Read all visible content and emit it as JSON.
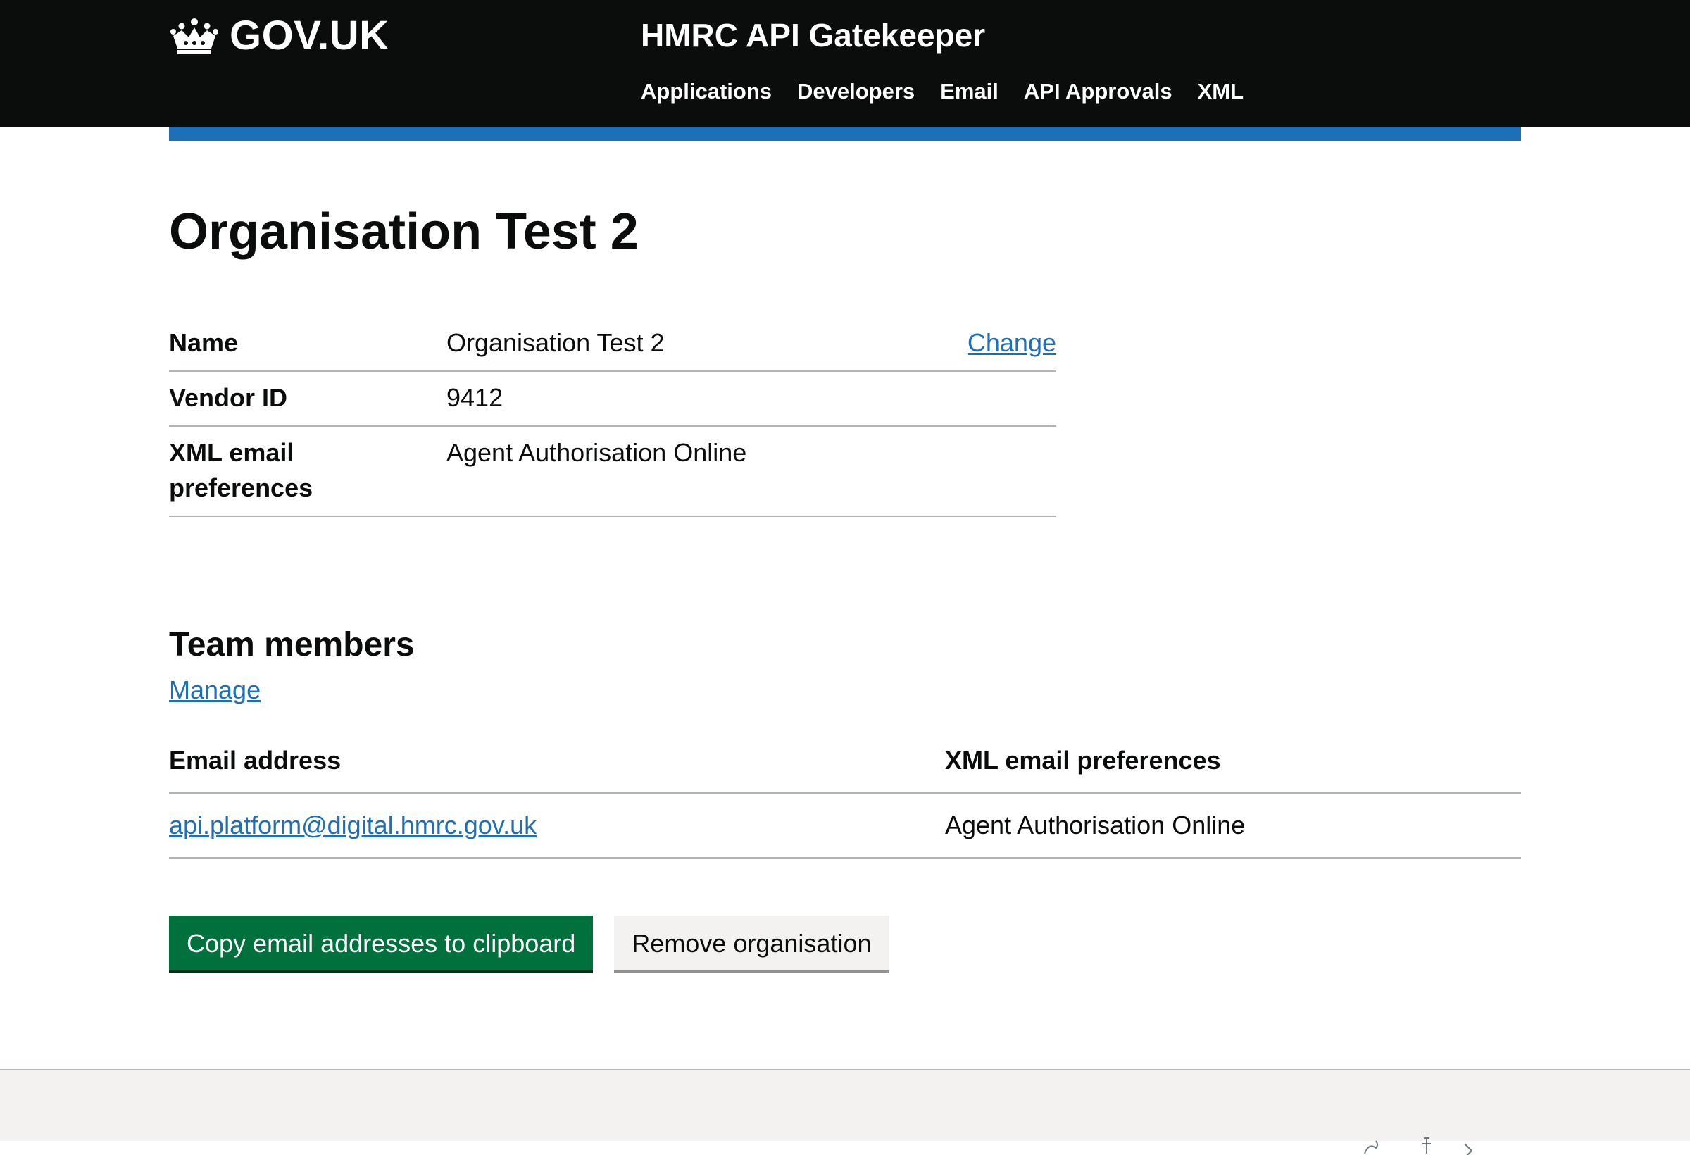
{
  "header": {
    "logo_text": "GOV.UK",
    "service_name": "HMRC API Gatekeeper",
    "nav": [
      {
        "label": "Applications"
      },
      {
        "label": "Developers"
      },
      {
        "label": "Email"
      },
      {
        "label": "API Approvals"
      },
      {
        "label": "XML"
      }
    ]
  },
  "page": {
    "title": "Organisation Test 2"
  },
  "summary": {
    "rows": [
      {
        "key": "Name",
        "value": "Organisation Test 2",
        "action": "Change"
      },
      {
        "key": "Vendor ID",
        "value": "9412"
      },
      {
        "key": "XML email preferences",
        "value": "Agent Authorisation Online"
      }
    ]
  },
  "team": {
    "heading": "Team members",
    "manage_label": "Manage",
    "columns": [
      "Email address",
      "XML email preferences"
    ],
    "rows": [
      {
        "email": "api.platform@digital.hmrc.gov.uk",
        "preferences": "Agent Authorisation Online"
      }
    ]
  },
  "actions": {
    "copy_label": "Copy email addresses to clipboard",
    "remove_label": "Remove organisation"
  },
  "colors": {
    "header_bg": "#0b0c0c",
    "accent_bar": "#1d70b8",
    "link": "#1d70b8",
    "primary_button": "#00703c",
    "secondary_button": "#f3f2f1",
    "footer_bg": "#f3f2f1"
  }
}
